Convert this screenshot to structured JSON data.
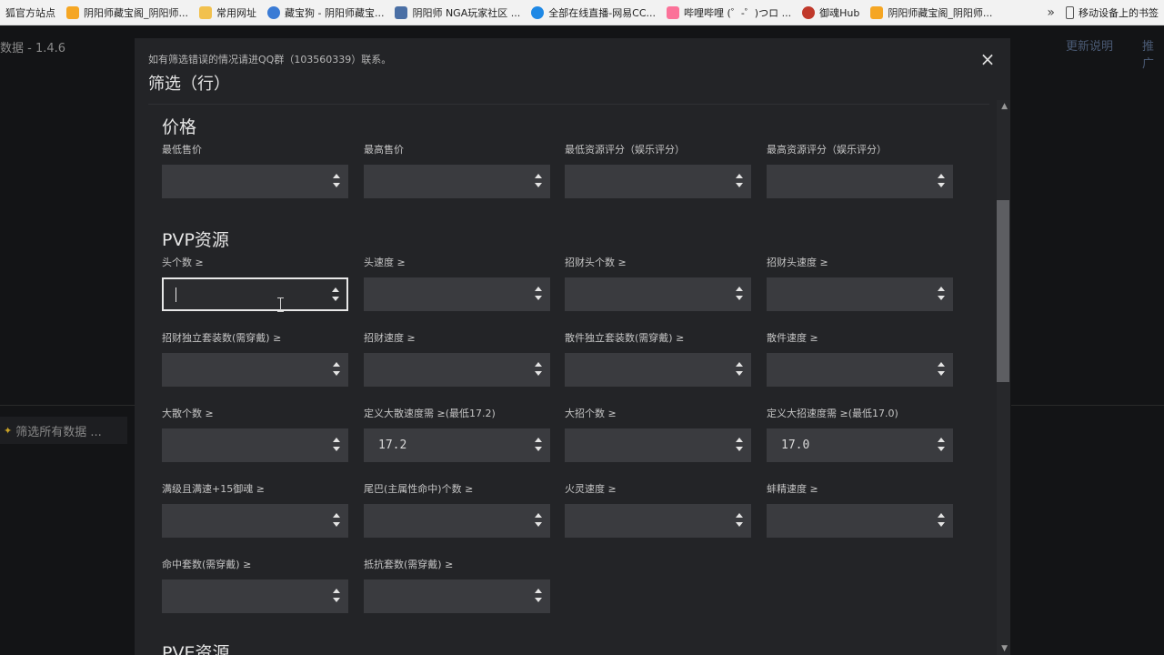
{
  "bookmarks": [
    {
      "label": "狐官方站点",
      "color": "#ff7a00"
    },
    {
      "label": "阴阳师藏宝阁_阴阳师...",
      "color": "#f5a623"
    },
    {
      "label": "常用网址",
      "color": "#f2c14e"
    },
    {
      "label": "藏宝狗 - 阴阳师藏宝...",
      "color": "#3a7bd5"
    },
    {
      "label": "阴阳师 NGA玩家社区 ...",
      "color": "#4a6fa5"
    },
    {
      "label": "全部在线直播-网易CC...",
      "color": "#1e88e5"
    },
    {
      "label": "哔哩哔哩 (゜-゜)つロ ...",
      "color": "#fb7299"
    },
    {
      "label": "御魂Hub",
      "color": "#c0392b"
    },
    {
      "label": "阴阳师藏宝阁_阴阳师...",
      "color": "#f5a623"
    }
  ],
  "bookmarks_more": "»",
  "mobile_bookmarks": "移动设备上的书签",
  "app": {
    "version": "数据 - 1.4.6",
    "nav_update": "更新说明",
    "nav_promo": "推广",
    "filter_all": "筛选所有数据 ..."
  },
  "modal": {
    "notice": "如有筛选错误的情况请进QQ群（103560339）联系。",
    "title": "筛选（行）",
    "close": "×",
    "sections": {
      "price": {
        "title": "价格",
        "fields": [
          {
            "label": "最低售价",
            "value": ""
          },
          {
            "label": "最高售价",
            "value": ""
          },
          {
            "label": "最低资源评分（娱乐评分）",
            "value": ""
          },
          {
            "label": "最高资源评分（娱乐评分）",
            "value": ""
          }
        ]
      },
      "pvp": {
        "title": "PVP资源",
        "fields": [
          {
            "label": "头个数 ≥",
            "value": ""
          },
          {
            "label": "头速度 ≥",
            "value": ""
          },
          {
            "label": "招财头个数 ≥",
            "value": ""
          },
          {
            "label": "招财头速度 ≥",
            "value": ""
          },
          {
            "label": "招财独立套装数(需穿戴) ≥",
            "value": ""
          },
          {
            "label": "招财速度 ≥",
            "value": ""
          },
          {
            "label": "散件独立套装数(需穿戴) ≥",
            "value": ""
          },
          {
            "label": "散件速度 ≥",
            "value": ""
          },
          {
            "label": "大散个数 ≥",
            "value": ""
          },
          {
            "label": "定义大散速度需 ≥(最低17.2)",
            "value": "17.2"
          },
          {
            "label": "大招个数 ≥",
            "value": ""
          },
          {
            "label": "定义大招速度需 ≥(最低17.0)",
            "value": "17.0"
          },
          {
            "label": "满级且满速+15御魂 ≥",
            "value": ""
          },
          {
            "label": "尾巴(主属性命中)个数 ≥",
            "value": ""
          },
          {
            "label": "火灵速度 ≥",
            "value": ""
          },
          {
            "label": "蚌精速度 ≥",
            "value": ""
          },
          {
            "label": "命中套数(需穿戴) ≥",
            "value": ""
          },
          {
            "label": "抵抗套数(需穿戴) ≥",
            "value": ""
          }
        ]
      },
      "pve": {
        "title": "PVE资源"
      }
    }
  }
}
